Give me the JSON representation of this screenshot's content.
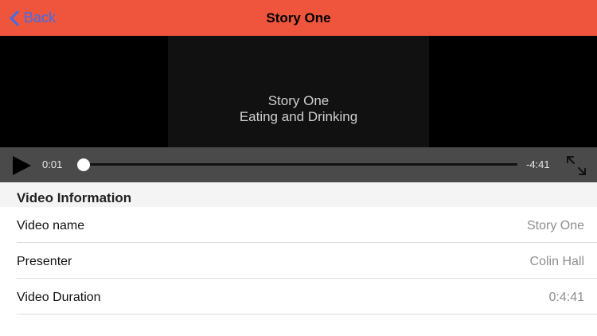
{
  "nav": {
    "back_label": "Back",
    "title": "Story One"
  },
  "video": {
    "caption_line1": "Story One",
    "caption_line2": "Eating and Drinking"
  },
  "controls": {
    "current_time": "0:01",
    "remaining_time": "-4:41",
    "progress_fraction": 0.004,
    "icons": [
      "play-icon",
      "fullscreen-icon"
    ]
  },
  "info": {
    "header": "Video Information",
    "rows": [
      {
        "label": "Video name",
        "value": "Story One"
      },
      {
        "label": "Presenter",
        "value": "Colin Hall"
      },
      {
        "label": "Video Duration",
        "value": "0:4:41"
      }
    ]
  },
  "colors": {
    "navbar": "#ee553c",
    "back_tint": "#3a6ff0",
    "controls_bg": "#4a4a4a"
  }
}
